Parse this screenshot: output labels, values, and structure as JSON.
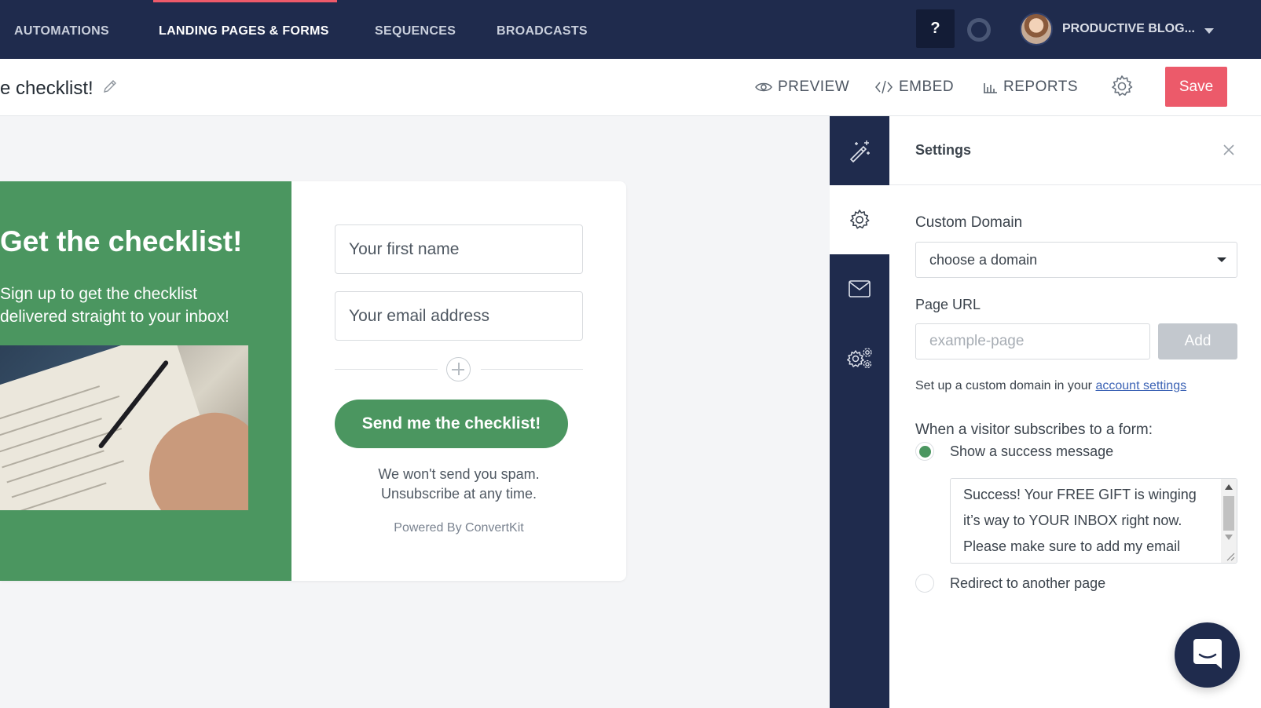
{
  "nav": {
    "items": [
      {
        "label": "AUTOMATIONS"
      },
      {
        "label": "LANDING PAGES & FORMS"
      },
      {
        "label": "SEQUENCES"
      },
      {
        "label": "BROADCASTS"
      }
    ],
    "help_label": "?",
    "account_name": "PRODUCTIVE BLOG...",
    "active_color": "#ee5a6a"
  },
  "toolbar": {
    "page_title": "e checklist!",
    "preview_label": "PREVIEW",
    "embed_label": "EMBED",
    "reports_label": "REPORTS",
    "save_label": "Save"
  },
  "form": {
    "heading": "Get the checklist!",
    "subheading": "Sign up to get the checklist delivered straight to your inbox!",
    "first_name_placeholder": "Your first name",
    "email_placeholder": "Your email address",
    "cta_label": "Send me the checklist!",
    "disclaimer_line1": "We won't send you spam.",
    "disclaimer_line2": "Unsubscribe at any time.",
    "powered_by": "Powered By ConvertKit",
    "accent_color": "#4b9660"
  },
  "sidebar": {
    "tabs": [
      {
        "icon": "magic-wand-icon"
      },
      {
        "icon": "gear-icon"
      },
      {
        "icon": "envelope-icon"
      },
      {
        "icon": "advanced-gears-icon"
      }
    ],
    "active_index": 1
  },
  "settings": {
    "title": "Settings",
    "custom_domain_label": "Custom Domain",
    "domain_selected": "choose a domain",
    "page_url_label": "Page URL",
    "page_url_placeholder": "example-page",
    "add_label": "Add",
    "helper_text": "Set up a custom domain in your",
    "helper_link": "account settings",
    "subscribe_heading": "When a visitor subscribes to a form:",
    "option_success": "Show a success message",
    "success_message_line1": "Success! Your FREE GIFT is winging",
    "success_message_line2": "it’s way to YOUR INBOX right now.",
    "success_message_line3": "Please make sure to add my email",
    "option_redirect": "Redirect to another page"
  }
}
